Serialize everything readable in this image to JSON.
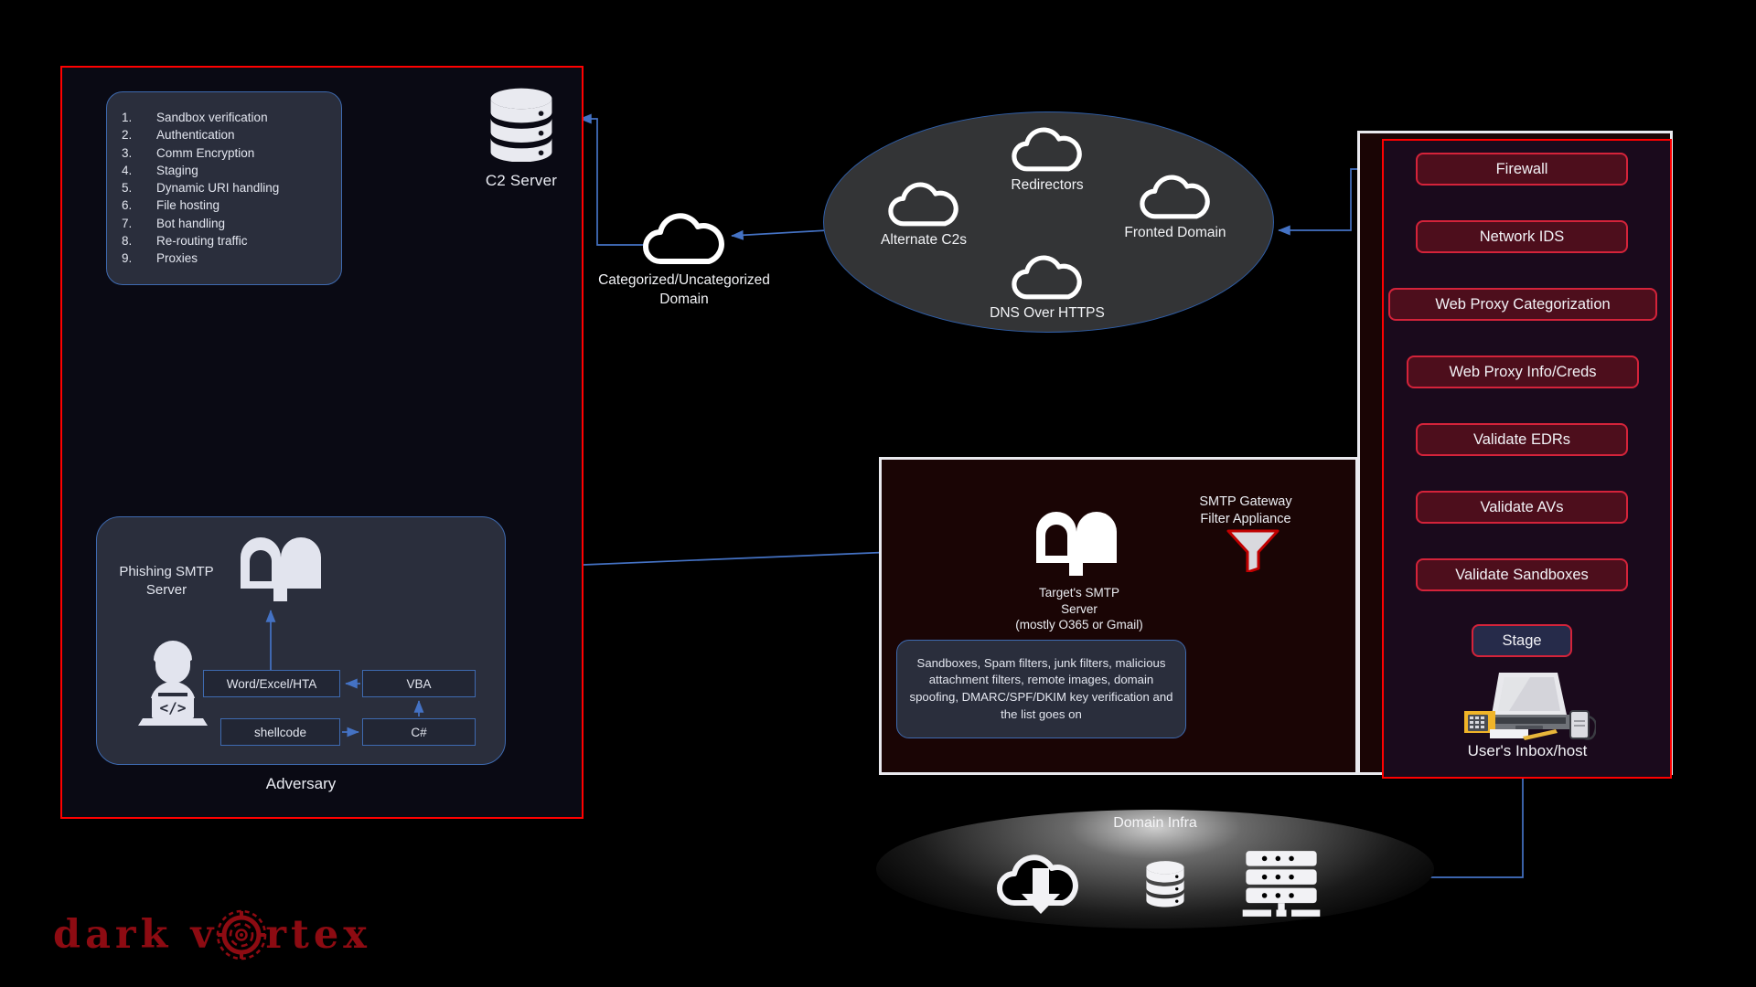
{
  "adversary": {
    "panel_name": "Adversary red boundary",
    "caption": "Adversary",
    "phishing_smtp_label": "Phishing SMTP\nServer",
    "c2_features": [
      {
        "num": "1.",
        "text": "Sandbox verification"
      },
      {
        "num": "2.",
        "text": "Authentication"
      },
      {
        "num": "3.",
        "text": "Comm Encryption"
      },
      {
        "num": "4.",
        "text": "Staging"
      },
      {
        "num": "5.",
        "text": "Dynamic URI handling"
      },
      {
        "num": "6.",
        "text": "File hosting"
      },
      {
        "num": "7.",
        "text": "Bot handling"
      },
      {
        "num": "8.",
        "text": "Re-routing traffic"
      },
      {
        "num": "9.",
        "text": "Proxies"
      }
    ],
    "c2_server_label": "C2 Server",
    "payload_chain": {
      "word": "Word/Excel/HTA",
      "vba": "VBA",
      "shellcode": "shellcode",
      "csharp": "C#"
    }
  },
  "categorized_domain": {
    "label": "Categorized/Uncategorized\nDomain",
    "icon": "cloud-icon"
  },
  "cloud_ellipse": {
    "nodes": [
      {
        "label": "Redirectors",
        "icon": "cloud-icon"
      },
      {
        "label": "Alternate C2s",
        "icon": "cloud-icon"
      },
      {
        "label": "Fronted Domain",
        "icon": "cloud-icon"
      },
      {
        "label": "DNS Over HTTPS",
        "icon": "cloud-icon"
      }
    ]
  },
  "target": {
    "smtp_label": "Target's SMTP\nServer\n(mostly O365 or Gmail)",
    "gateway_label": "SMTP Gateway\nFilter Appliance",
    "gateway_icon": "funnel-icon",
    "mailbox_icon": "mailbox-icon",
    "filters_text": "Sandboxes, Spam filters, junk filters, malicious attachment filters, remote images, domain spoofing, DMARC/SPF/DKIM key verification and the list goes on"
  },
  "defense_stack": {
    "items": [
      {
        "label": "Firewall",
        "type": "defense"
      },
      {
        "label": "Network IDS",
        "type": "defense"
      },
      {
        "label": "Web Proxy Categorization",
        "type": "defense"
      },
      {
        "label": "Web Proxy Info/Creds",
        "type": "defense"
      },
      {
        "label": "Validate EDRs",
        "type": "defense"
      },
      {
        "label": "Validate AVs",
        "type": "defense"
      },
      {
        "label": "Validate Sandboxes",
        "type": "defense"
      },
      {
        "label": "Stage",
        "type": "stage"
      }
    ],
    "host_label": "User's Inbox/host",
    "host_icon": "desk-laptop-icon"
  },
  "domain_infra": {
    "label": "Domain Infra",
    "icons": [
      "cloud-download-icon",
      "database-icon",
      "server-rack-icon"
    ]
  },
  "logo": {
    "part1": "dark v",
    "part2": "rtex",
    "vortex_icon": "vortex-icon",
    "color": "#8d0b12"
  },
  "colors": {
    "background": "#000000",
    "adversary_border": "#ff0000",
    "panel_border_white": "#e9e9ee",
    "wire": "#4472c4",
    "card_fill": "#2a2e3c",
    "card_border": "#3e6ab0",
    "defense_fill": "#4d0e1c",
    "defense_border": "#d4233a",
    "stage_fill": "#262b4a"
  }
}
